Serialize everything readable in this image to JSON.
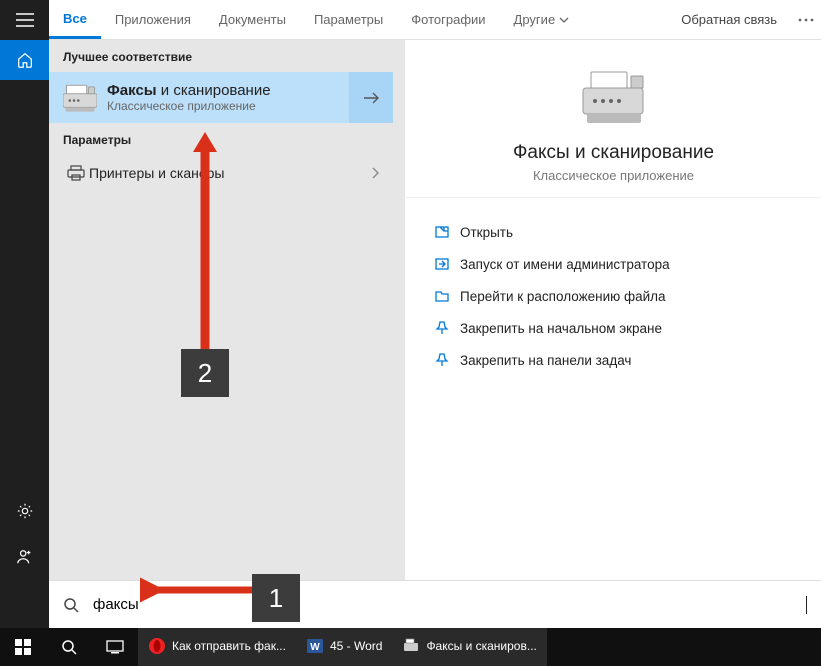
{
  "tabs": {
    "all": "Все",
    "apps": "Приложения",
    "docs": "Документы",
    "settings": "Параметры",
    "photos": "Фотографии",
    "more": "Другие"
  },
  "feedback": "Обратная связь",
  "section_best": "Лучшее соответствие",
  "best": {
    "title_bold": "Факсы",
    "title_rest": " и сканирование",
    "subtitle": "Классическое приложение"
  },
  "section_settings": "Параметры",
  "settings_item": "Принтеры и сканеры",
  "preview": {
    "title": "Факсы и сканирование",
    "subtitle": "Классическое приложение"
  },
  "actions": {
    "open": "Открыть",
    "admin": "Запуск от имени администратора",
    "location": "Перейти к расположению файла",
    "pin_start": "Закрепить на начальном экране",
    "pin_taskbar": "Закрепить на панели задач"
  },
  "search_value": "факсы",
  "taskbar": {
    "opera": "Как отправить фак...",
    "word": "45 - Word",
    "fax": "Факсы и сканиров..."
  },
  "annotations": {
    "n1": "1",
    "n2": "2"
  }
}
